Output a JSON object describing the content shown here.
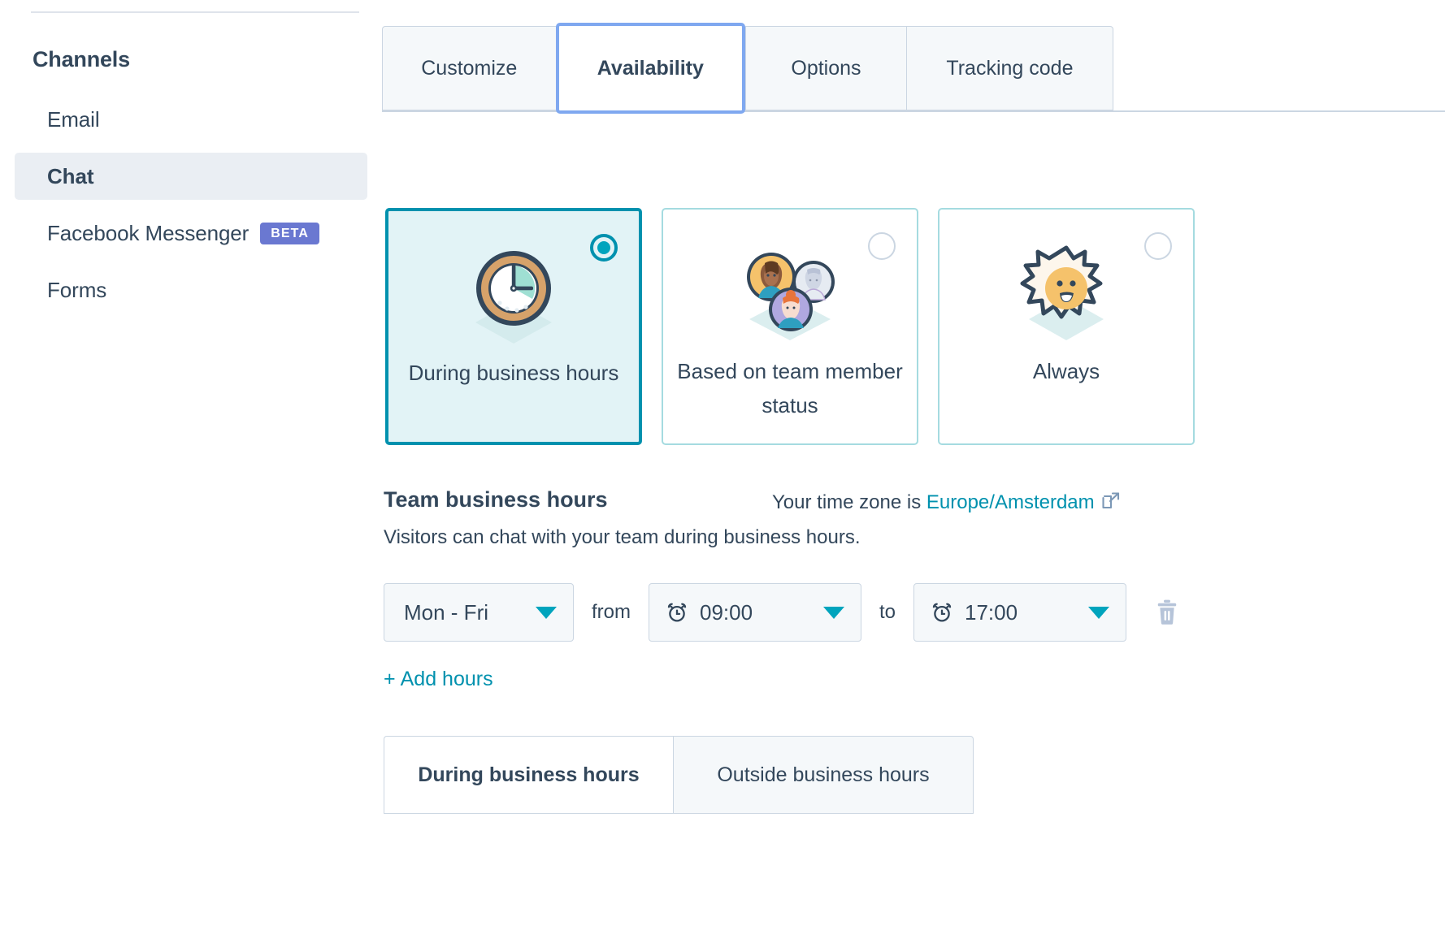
{
  "sidebar": {
    "heading": "Channels",
    "items": [
      {
        "label": "Email",
        "active": false,
        "badge": null
      },
      {
        "label": "Chat",
        "active": true,
        "badge": null
      },
      {
        "label": "Facebook Messenger",
        "active": false,
        "badge": "BETA"
      },
      {
        "label": "Forms",
        "active": false,
        "badge": null
      }
    ]
  },
  "tabs": [
    {
      "label": "Customize",
      "selected": false
    },
    {
      "label": "Availability",
      "selected": true
    },
    {
      "label": "Options",
      "selected": false
    },
    {
      "label": "Tracking code",
      "selected": false
    }
  ],
  "availability_options": [
    {
      "label": "During business hours",
      "selected": true,
      "icon": "clock-illustration"
    },
    {
      "label": "Based on team member status",
      "selected": false,
      "icon": "team-avatars-illustration"
    },
    {
      "label": "Always",
      "selected": false,
      "icon": "sun-illustration"
    }
  ],
  "business_hours": {
    "title": "Team business hours",
    "timezone_prefix": "Your time zone is",
    "timezone_value": "Europe/Amsterdam",
    "description": "Visitors can chat with your team during business hours.",
    "row": {
      "days": "Mon - Fri",
      "from_label": "from",
      "from_time": "09:00",
      "to_label": "to",
      "to_time": "17:00"
    },
    "add_hours_plus": "+",
    "add_hours_label": "Add hours"
  },
  "bottom_tabs": [
    {
      "label": "During business hours",
      "active": true
    },
    {
      "label": "Outside business hours",
      "active": false
    }
  ],
  "colors": {
    "accent_teal": "#0091ae",
    "accent_cyan": "#00a4bd",
    "text_dark": "#33475b",
    "border": "#cbd6e2",
    "focus_blue": "#7fa8f0",
    "beta_purple": "#6a78d1",
    "card_selected_bg": "#e2f3f6",
    "nav_active_bg": "#eaeef3"
  }
}
